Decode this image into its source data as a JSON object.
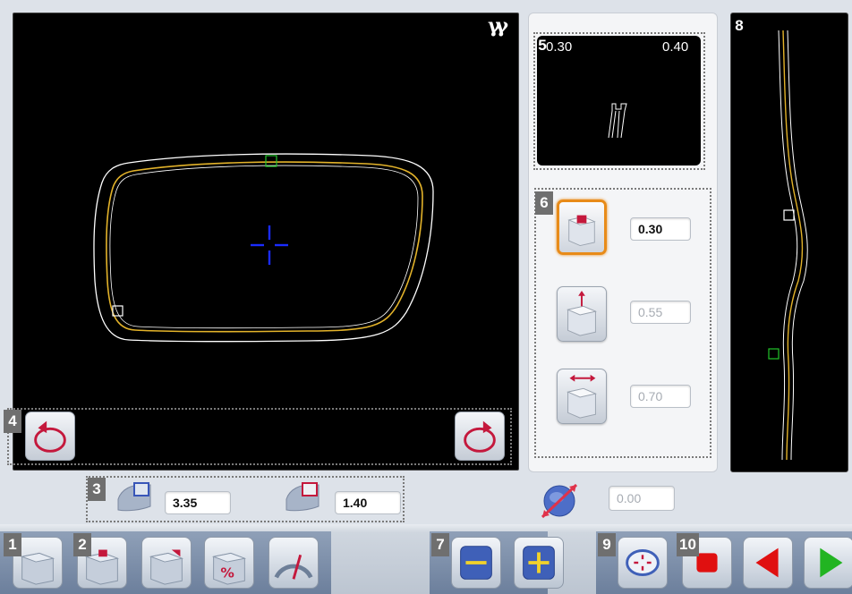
{
  "panel_numbers": [
    "1",
    "2",
    "3",
    "4",
    "5",
    "6",
    "7",
    "8",
    "9",
    "10"
  ],
  "logo_glyph": "γγ",
  "top_view": {
    "value_left": "0.30",
    "value_right": "0.40"
  },
  "bevel_settings": {
    "value_1": "0.30",
    "value_2": "0.55",
    "value_3": "0.70"
  },
  "bevel_size": {
    "value_a": "3.35",
    "value_b": "1.40"
  },
  "axis_field": "0.00",
  "colors": {
    "frame_outer": "#ffffff",
    "frame_inner": "#e3b32a",
    "crosshair": "#1a2cff",
    "selected_border": "#e88b19",
    "play_green": "#22b422",
    "back_red": "#e01010"
  }
}
